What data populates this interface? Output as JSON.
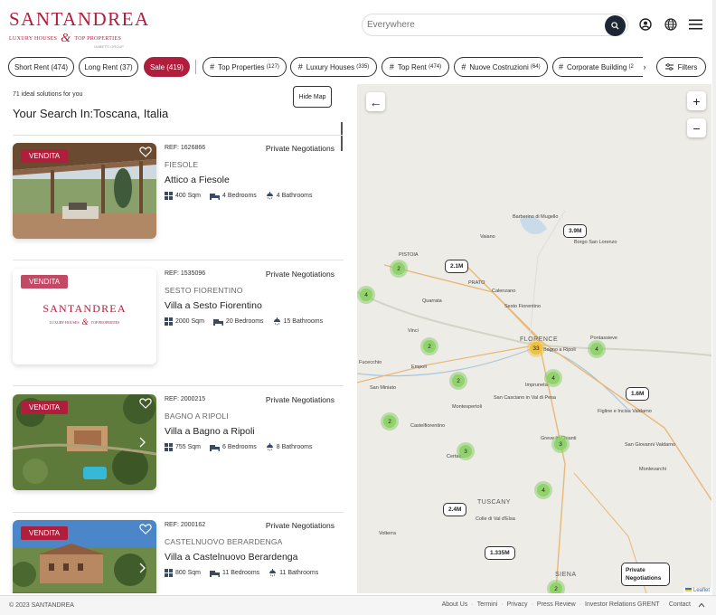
{
  "brand": {
    "name": "SANTANDREA",
    "sub_left": "LUXURY HOUSES",
    "amp": "&",
    "sub_right": "TOP PROPERTIES",
    "tiny": "GABETTI GROUP"
  },
  "search": {
    "placeholder": "Everywhere"
  },
  "filters": [
    {
      "label": "Short Rent (474)"
    },
    {
      "label": "Long Rent (37)"
    },
    {
      "label": "Sale (419)"
    },
    {
      "label": "Top Properties",
      "count": "(127)"
    },
    {
      "label": "Luxury Houses",
      "count": "(335)"
    },
    {
      "label": "Top Rent",
      "count": "(474)"
    },
    {
      "label": "Nuove Costruzioni",
      "count": "(64)"
    },
    {
      "label": "Corporate Building",
      "count": "(2"
    },
    {
      "label": "Filters"
    }
  ],
  "results": {
    "count_text": "71 ideal solutions for you",
    "hide_map": "Hide Map",
    "title": "Your Search In:Toscana, Italia"
  },
  "listings": [
    {
      "badge": "VENDITA",
      "ref": "REF: 1626866",
      "nego": "Private Negotiations",
      "town": "FIESOLE",
      "name": "Attico a Fiesole",
      "sqm": "400 Sqm",
      "bedrooms": "4 Bedrooms",
      "bathrooms": "4 Bathrooms"
    },
    {
      "badge": "VENDITA",
      "ref": "REF: 1535096",
      "nego": "Private Negotiations",
      "town": "SESTO FIORENTINO",
      "name": "Villa a Sesto Fiorentino",
      "sqm": "2000 Sqm",
      "bedrooms": "20 Bedrooms",
      "bathrooms": "15 Bathrooms"
    },
    {
      "badge": "VENDITA",
      "ref": "REF: 2000215",
      "nego": "Private Negotiations",
      "town": "BAGNO A RIPOLI",
      "name": "Villa a Bagno a Ripoli",
      "sqm": "755 Sqm",
      "bedrooms": "6 Bedrooms",
      "bathrooms": "8 Bathrooms"
    },
    {
      "badge": "VENDITA",
      "ref": "REF: 2000162",
      "nego": "Private Negotiations",
      "town": "CASTELNUOVO BERARDENGA",
      "name": "Villa a Castelnuovo Berardenga",
      "sqm": "800 Sqm",
      "bedrooms": "11 Bedrooms",
      "bathrooms": "11 Bathrooms"
    }
  ],
  "map": {
    "zoom_in": "+",
    "zoom_out": "−",
    "prices": [
      "3.9M",
      "2.1M",
      "1.6M",
      "2.4M",
      "1.335M"
    ],
    "clusters": [
      "2",
      "4",
      "2",
      "33",
      "4",
      "2",
      "4",
      "2",
      "3",
      "3",
      "4",
      "2"
    ],
    "places": [
      "Barberino di Mugello",
      "Vaiano",
      "Borgo San Lorenzo",
      "PISTOIA",
      "PRATO",
      "Calenzano",
      "Quarrata",
      "Sesto Fiorentino",
      "Vinci",
      "FLORENCE",
      "Pontassieve",
      "Bagno a Ripoli",
      "Fucecchio",
      "Empoli",
      "San Miniato",
      "Impruneta",
      "Montespertoli",
      "San Casciano in Val di Pesa",
      "Figline e Incisa Valdarno",
      "Castelfiorentino",
      "Greve in Chianti",
      "San Giovanni Valdarno",
      "Certaldo",
      "Montevarchi",
      "TUSCANY",
      "Colle di Val d'Elsa",
      "Volterra",
      "SIENA"
    ],
    "pn_line1": "Private",
    "pn_line2": "Negotiations",
    "attribution": "Leaflet"
  },
  "footer": {
    "copyright": "© 2023 SANTANDREA",
    "links": [
      "About Us",
      "Termini",
      "Privacy",
      "Press Review",
      "Investor Relations GRENT",
      "Contact"
    ]
  }
}
